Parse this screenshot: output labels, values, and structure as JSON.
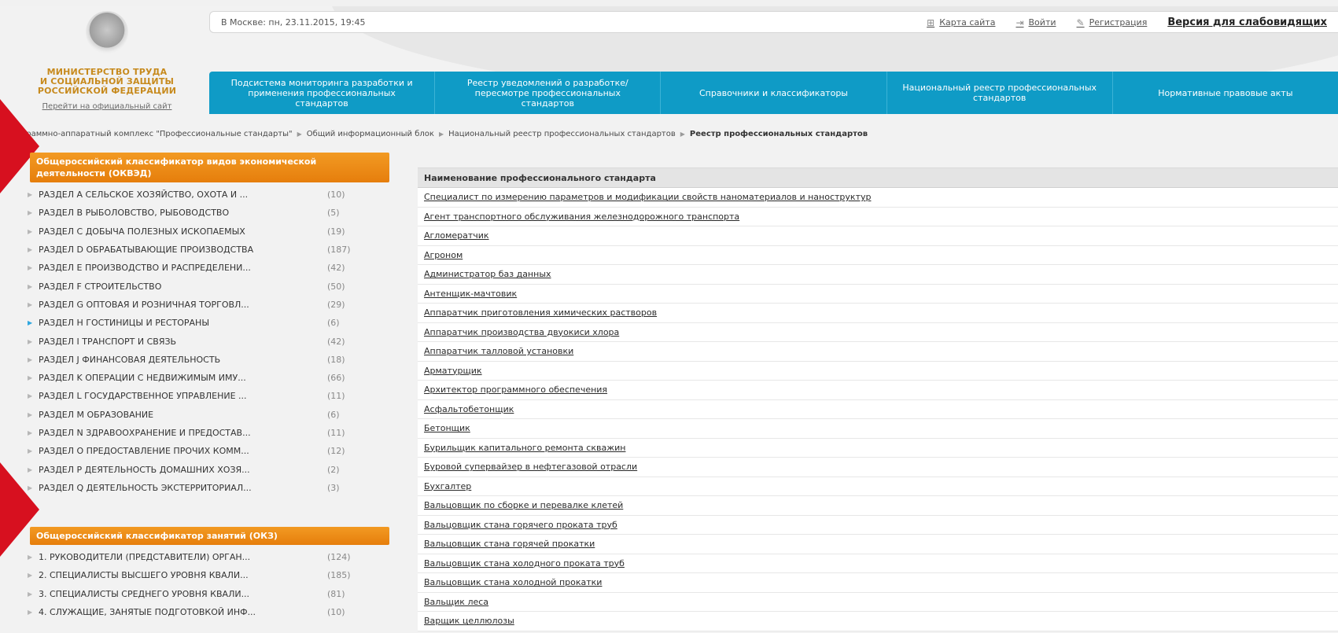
{
  "header": {
    "ministry_lines": [
      "МИНИСТЕРСТВО ТРУДА",
      "И СОЦИАЛЬНОЙ ЗАЩИТЫ",
      "РОССИЙСКОЙ ФЕДЕРАЦИИ"
    ],
    "official_link": "Перейти на официальный сайт",
    "datetime": "В Москве: пн, 23.11.2015, 19:45",
    "links": {
      "sitemap": "Карта сайта",
      "login": "Войти",
      "register": "Регистрация",
      "accessible": "Версия для слабовидящих"
    }
  },
  "nav": [
    "Подсистема мониторинга разработки и применения профессиональных стандартов",
    "Реестр уведомлений о разработке/ пересмотре профессиональных стандартов",
    "Справочники и классификаторы",
    "Национальный реестр профессиональных стандартов",
    "Нормативные правовые акты"
  ],
  "breadcrumb": [
    "Программно-аппаратный комплекс \"Профессиональные стандарты\"",
    "Общий информационный блок",
    "Национальный реестр профессиональных стандартов",
    "Реестр профессиональных стандартов"
  ],
  "okved": {
    "title": "Общероссийский классификатор видов экономической деятельности (ОКВЭД)",
    "items": [
      {
        "label": "РАЗДЕЛ A СЕЛЬСКОЕ ХОЗЯЙСТВО, ОХОТА И ...",
        "count": "(10)"
      },
      {
        "label": "РАЗДЕЛ B РЫБОЛОВСТВО, РЫБОВОДСТВО",
        "count": "(5)"
      },
      {
        "label": "РАЗДЕЛ C ДОБЫЧА ПОЛЕЗНЫХ ИСКОПАЕМЫХ",
        "count": "(19)"
      },
      {
        "label": "РАЗДЕЛ D ОБРАБАТЫВАЮЩИЕ ПРОИЗВОДСТВА",
        "count": "(187)"
      },
      {
        "label": "РАЗДЕЛ E ПРОИЗВОДСТВО И РАСПРЕДЕЛЕНИ...",
        "count": "(42)"
      },
      {
        "label": "РАЗДЕЛ F СТРОИТЕЛЬСТВО",
        "count": "(50)"
      },
      {
        "label": "РАЗДЕЛ G ОПТОВАЯ И РОЗНИЧНАЯ ТОРГОВЛ...",
        "count": "(29)"
      },
      {
        "label": "РАЗДЕЛ H ГОСТИНИЦЫ И РЕСТОРАНЫ",
        "count": "(6)"
      },
      {
        "label": "РАЗДЕЛ I ТРАНСПОРТ И СВЯЗЬ",
        "count": "(42)"
      },
      {
        "label": "РАЗДЕЛ J ФИНАНСОВАЯ ДЕЯТЕЛЬНОСТЬ",
        "count": "(18)"
      },
      {
        "label": "РАЗДЕЛ K ОПЕРАЦИИ С НЕДВИЖИМЫМ ИМУ...",
        "count": "(66)"
      },
      {
        "label": "РАЗДЕЛ L ГОСУДАРСТВЕННОЕ УПРАВЛЕНИЕ ...",
        "count": "(11)"
      },
      {
        "label": "РАЗДЕЛ M ОБРАЗОВАНИЕ",
        "count": "(6)"
      },
      {
        "label": "РАЗДЕЛ N ЗДРАВООХРАНЕНИЕ И ПРЕДОСТАВ...",
        "count": "(11)"
      },
      {
        "label": "РАЗДЕЛ O ПРЕДОСТАВЛЕНИЕ ПРОЧИХ КОММ...",
        "count": "(12)"
      },
      {
        "label": "РАЗДЕЛ P ДЕЯТЕЛЬНОСТЬ ДОМАШНИХ ХОЗЯ...",
        "count": "(2)"
      },
      {
        "label": "РАЗДЕЛ Q ДЕЯТЕЛЬНОСТЬ ЭКСТЕРРИТОРИАЛ...",
        "count": "(3)"
      }
    ]
  },
  "okz": {
    "title": "Общероссийский классификатор занятий (ОКЗ)",
    "items": [
      {
        "label": "1. РУКОВОДИТЕЛИ (ПРЕДСТАВИТЕЛИ) ОРГАН...",
        "count": "(124)"
      },
      {
        "label": "2. СПЕЦИАЛИСТЫ ВЫСШЕГО УРОВНЯ КВАЛИ...",
        "count": "(185)"
      },
      {
        "label": "3. СПЕЦИАЛИСТЫ СРЕДНЕГО УРОВНЯ КВАЛИ...",
        "count": "(81)"
      },
      {
        "label": "4. СЛУЖАЩИЕ, ЗАНЯТЫЕ ПОДГОТОВКОЙ ИНФ...",
        "count": "(10)"
      }
    ]
  },
  "table": {
    "header": "Наименование профессионального стандарта",
    "rows": [
      "Специалист по измерению параметров и модификации свойств наноматериалов и наноструктур",
      "Агент транспортного обслуживания железнодорожного транспорта",
      "Агломератчик",
      "Агроном",
      "Администратор баз данных",
      "Антенщик-мачтовик",
      "Аппаратчик приготовления химических растворов",
      "Аппаратчик производства двуокиси хлора",
      "Аппаратчик талловой установки",
      "Арматурщик",
      "Архитектор программного обеспечения",
      "Асфальтобетонщик",
      "Бетонщик",
      "Бурильщик капитального ремонта скважин",
      "Буровой супервайзер в нефтегазовой отрасли",
      "Бухгалтер",
      "Вальцовщик по сборке и перевалке клетей",
      "Вальцовщик стана горячего проката труб",
      "Вальцовщик стана горячей прокатки",
      "Вальцовщик стана холодного проката труб",
      "Вальцовщик стана холодной прокатки",
      "Вальщик леса",
      "Варщик целлюлозы"
    ]
  },
  "colors": {
    "nav_blue": "#0f9bc6",
    "orange": "#ef8a10",
    "red_marker": "#d7101f",
    "ministry_gold": "#c78a1d"
  }
}
